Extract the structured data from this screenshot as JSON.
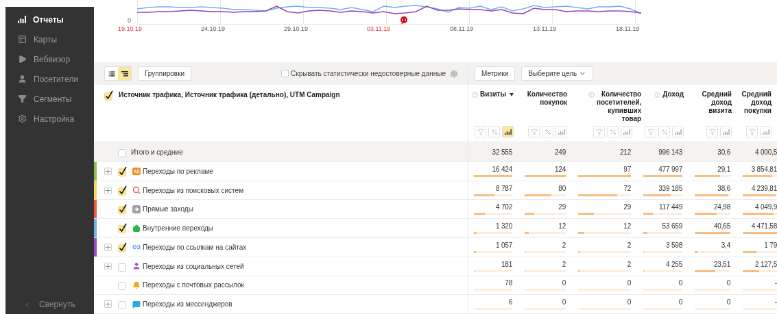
{
  "sidebar": {
    "items": [
      {
        "label": "Отчеты",
        "kind": "reports",
        "selected": true
      },
      {
        "label": "Карты",
        "kind": "maps",
        "selected": false
      },
      {
        "label": "Вебвизор",
        "kind": "webvisor",
        "selected": false
      },
      {
        "label": "Посетители",
        "kind": "visitors",
        "selected": false
      },
      {
        "label": "Сегменты",
        "kind": "segments",
        "selected": false
      },
      {
        "label": "Настройка",
        "kind": "settings",
        "selected": false
      }
    ],
    "collapse": "Свернуть"
  },
  "chart": {
    "y_tick": "0",
    "x_labels": [
      {
        "label": "19.10.19",
        "weekend": true
      },
      {
        "label": "24.10.19",
        "weekend": false
      },
      {
        "label": "29.10.19",
        "weekend": false
      },
      {
        "label": "03.11.19",
        "weekend": true
      },
      {
        "label": "08.11.19",
        "weekend": false
      },
      {
        "label": "13.11.19",
        "weekend": false
      },
      {
        "label": "18.11.19",
        "weekend": false
      }
    ]
  },
  "toolbar": {
    "views": [
      {
        "kind": "list",
        "selected": false
      },
      {
        "kind": "tree",
        "selected": true
      }
    ],
    "groupings_button": "Группировки",
    "hide_unreliable": {
      "label": "Скрывать статистически недостоверные данные",
      "checked": false
    },
    "metrics_button": "Метрики",
    "goal_select": "Выберите цель"
  },
  "table": {
    "dimension": {
      "label": "Источник трафика, Источник трафика (детально), UTM Campaign",
      "checked": true
    },
    "columns": [
      {
        "label": "Визиты",
        "help": true,
        "sorted": true,
        "tools": [
          {
            "kind": "filter",
            "selected": false
          },
          {
            "kind": "percent",
            "selected": false
          },
          {
            "kind": "bars",
            "selected": true
          }
        ]
      },
      {
        "label": "Количество покупок",
        "help": false,
        "sorted": false,
        "tools": [
          {
            "kind": "filter",
            "selected": false
          },
          {
            "kind": "percent",
            "selected": false
          },
          {
            "kind": "bars",
            "selected": false
          }
        ]
      },
      {
        "label": "Количество посетителей, купивших товар",
        "help": true,
        "sorted": false,
        "tools": [
          {
            "kind": "filter",
            "selected": false
          },
          {
            "kind": "percent",
            "selected": false
          },
          {
            "kind": "bars",
            "selected": false
          }
        ]
      },
      {
        "label": "Доход",
        "help": true,
        "sorted": false,
        "tools": [
          {
            "kind": "filter",
            "selected": false
          },
          {
            "kind": "percent",
            "selected": false
          },
          {
            "kind": "bars",
            "selected": false
          }
        ]
      },
      {
        "label": "Средний доход визита",
        "help": false,
        "sorted": false,
        "tools": [
          {
            "kind": "filter",
            "selected": false
          },
          {
            "kind": "bars",
            "selected": false
          }
        ]
      },
      {
        "label": "Средний доход покупки",
        "help": false,
        "sorted": false,
        "tools": [
          {
            "kind": "filter",
            "selected": false
          },
          {
            "kind": "bars",
            "selected": false
          }
        ]
      }
    ],
    "totals": {
      "label": "Итого и средние",
      "checked": false,
      "values": [
        "32 555",
        "249",
        "212",
        "996 143",
        "30,6",
        "4 000,5"
      ]
    },
    "rows": [
      {
        "label": "Переходы по рекламе",
        "kind": "ad",
        "checked": true,
        "expandable": true,
        "color": "#8cc152",
        "cells": [
          {
            "value": "16 424",
            "level": 1
          },
          {
            "value": "124",
            "level": 1
          },
          {
            "value": "97",
            "level": 1
          },
          {
            "value": "477 997",
            "level": 1
          },
          {
            "value": "29,1",
            "level": 0.72
          },
          {
            "value": "3 854,81",
            "level": 0.86
          }
        ]
      },
      {
        "label": "Переходы из поисковых систем",
        "kind": "search",
        "checked": true,
        "expandable": true,
        "color": "#fcd35a",
        "cells": [
          {
            "value": "8 787",
            "level": 0.54
          },
          {
            "value": "80",
            "level": 0.65
          },
          {
            "value": "72",
            "level": 0.74
          },
          {
            "value": "339 185",
            "level": 0.71
          },
          {
            "value": "38,6",
            "level": 0.95
          },
          {
            "value": "4 239,81",
            "level": 0.95
          }
        ]
      },
      {
        "label": "Прямые заходы",
        "kind": "direct",
        "checked": true,
        "expandable": false,
        "color": "#f2583a",
        "cells": [
          {
            "value": "4 702",
            "level": 0.29
          },
          {
            "value": "29",
            "level": 0.23
          },
          {
            "value": "29",
            "level": 0.3
          },
          {
            "value": "117 449",
            "level": 0.25
          },
          {
            "value": "24,98",
            "level": 0.61
          },
          {
            "value": "4 049,9",
            "level": 0.9
          }
        ]
      },
      {
        "label": "Внутренние переходы",
        "kind": "internal",
        "checked": true,
        "expandable": false,
        "color": "#6fb3e8",
        "cells": [
          {
            "value": "1 320",
            "level": 0.08
          },
          {
            "value": "12",
            "level": 0.1
          },
          {
            "value": "12",
            "level": 0.12
          },
          {
            "value": "53 659",
            "level": 0.11
          },
          {
            "value": "40,65",
            "level": 1
          },
          {
            "value": "4 471,58",
            "level": 1
          }
        ]
      },
      {
        "label": "Переходы по ссылкам на сайтах",
        "kind": "link",
        "checked": true,
        "expandable": true,
        "color": "#9b4dca",
        "cells": [
          {
            "value": "1 057",
            "level": 0.06
          },
          {
            "value": "2",
            "level": 0.02
          },
          {
            "value": "2",
            "level": 0.02
          },
          {
            "value": "3 598",
            "level": 0.01
          },
          {
            "value": "3,4",
            "level": 0.08
          },
          {
            "value": "1 79",
            "level": 0.4
          }
        ]
      },
      {
        "label": "Переходы из социальных сетей",
        "kind": "social",
        "checked": false,
        "expandable": true,
        "cells": [
          {
            "value": "181",
            "level": 0.01
          },
          {
            "value": "2",
            "level": 0.02
          },
          {
            "value": "2",
            "level": 0.02
          },
          {
            "value": "4 255",
            "level": 0.01
          },
          {
            "value": "23,51",
            "level": 0.58
          },
          {
            "value": "2 127,5",
            "level": 0.47
          }
        ]
      },
      {
        "label": "Переходы с почтовых рассылок",
        "kind": "mail",
        "checked": false,
        "expandable": false,
        "cells": [
          {
            "value": "78"
          },
          {
            "value": "0"
          },
          {
            "value": "0"
          },
          {
            "value": "0"
          },
          {
            "value": "0"
          },
          {
            "value": "-"
          }
        ]
      },
      {
        "label": "Переходы из мессенджеров",
        "kind": "messenger",
        "checked": false,
        "expandable": true,
        "cells": [
          {
            "value": "6"
          },
          {
            "value": "0"
          },
          {
            "value": "0"
          },
          {
            "value": "0"
          },
          {
            "value": "0"
          },
          {
            "value": "-"
          }
        ]
      }
    ]
  }
}
